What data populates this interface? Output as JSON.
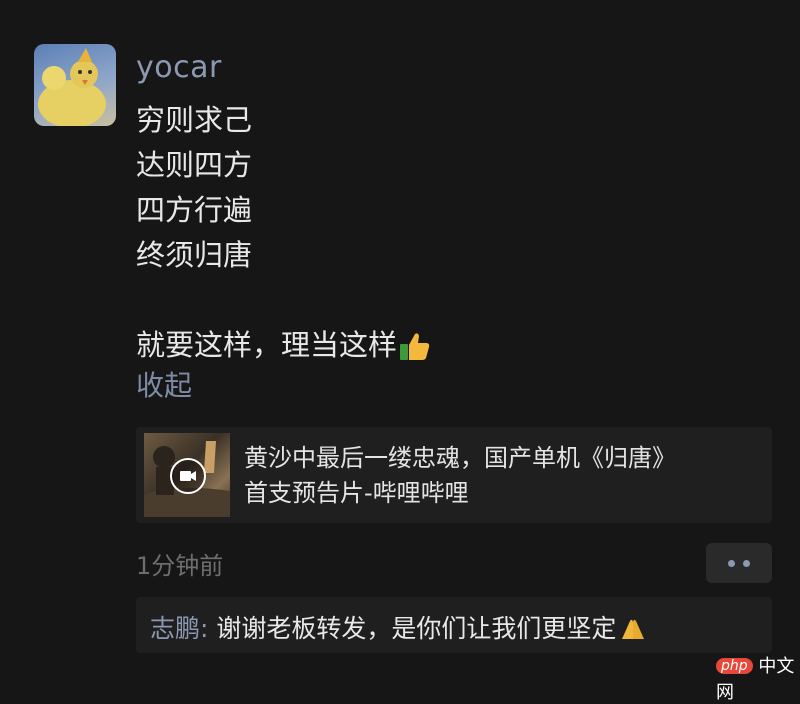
{
  "post": {
    "username": "yocar",
    "lines": [
      "穷则求己",
      "达则四方",
      "四方行遍",
      "终须归唐",
      "",
      "就要这样，理当这样"
    ],
    "collapse_label": "收起",
    "timestamp": "1分钟前"
  },
  "link_card": {
    "title_line1": "黄沙中最后一缕忠魂，国产单机《归唐》",
    "title_line2": "首支预告片-哔哩哔哩"
  },
  "comment": {
    "author": "志鹏",
    "separator": ": ",
    "text": "谢谢老板转发，是你们让我们更坚定"
  },
  "watermark": {
    "logo": "php",
    "text": "中文网"
  },
  "colors": {
    "background": "#161616",
    "name_blue": "#8c99b3",
    "text": "#e8e8e8",
    "card_bg": "#1f1f1f"
  },
  "icons": [
    "thumbs-up-emoji",
    "video-play-icon",
    "more-dots-icon",
    "praying-hands-emoji"
  ]
}
